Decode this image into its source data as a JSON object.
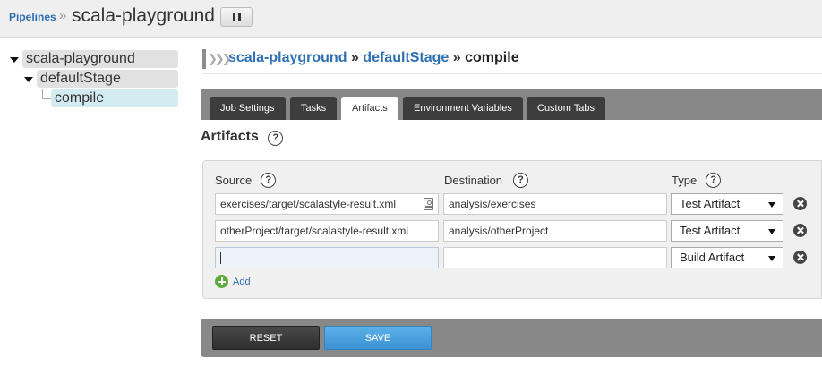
{
  "header": {
    "breadcrumb_link": "Pipelines",
    "breadcrumb_separator": "»",
    "pipeline_name": "scala-playground"
  },
  "tree": {
    "pipeline": "scala-playground",
    "stage": "defaultStage",
    "job": "compile"
  },
  "job_title": {
    "pipeline": "scala-playground",
    "sep1": "»",
    "stage": "defaultStage",
    "sep2": "»",
    "job": "compile"
  },
  "tabs": [
    {
      "label": "Job Settings"
    },
    {
      "label": "Tasks"
    },
    {
      "label": "Artifacts",
      "active": true
    },
    {
      "label": "Environment Variables"
    },
    {
      "label": "Custom Tabs"
    }
  ],
  "section": {
    "title": "Artifacts",
    "help": "?"
  },
  "columns": {
    "source": "Source",
    "destination": "Destination",
    "type": "Type",
    "help": "?"
  },
  "artifacts": [
    {
      "source": "exercises/target/scalastyle-result.xml",
      "destination": "analysis/exercises",
      "type": "Test Artifact"
    },
    {
      "source": "otherProject/target/scalastyle-result.xml",
      "destination": "analysis/otherProject",
      "type": "Test Artifact"
    },
    {
      "source": "",
      "destination": "",
      "type": "Build Artifact"
    }
  ],
  "add_label": "Add",
  "buttons": {
    "reset": "RESET",
    "save": "SAVE"
  },
  "colors": {
    "link": "#2e6fb4",
    "tab_bar": "#888888",
    "save_button": "#4aa3df"
  }
}
